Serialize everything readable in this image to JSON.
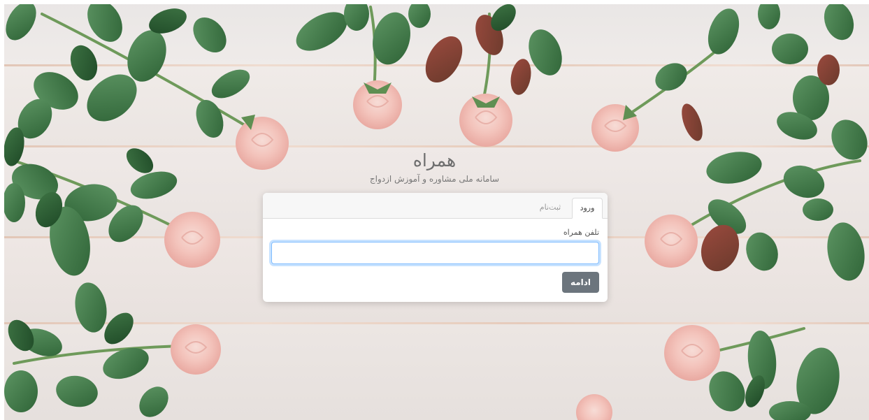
{
  "brand": {
    "title": "همراه",
    "subtitle": "سامانه ملی مشاوره و آموزش ازدواج"
  },
  "tabs": [
    {
      "label": "ورود",
      "active": true
    },
    {
      "label": "ثبت‌نام",
      "active": false
    }
  ],
  "form": {
    "phone_label": "تلفن همراه",
    "phone_value": "",
    "phone_placeholder": "",
    "continue_label": "ادامه"
  },
  "colors": {
    "button_bg": "#6c757d",
    "input_focus": "#80bdff",
    "rose_pink": "#f4c6c0",
    "leaf_green": "#3f7a45",
    "wood_white": "#ece6e2"
  }
}
